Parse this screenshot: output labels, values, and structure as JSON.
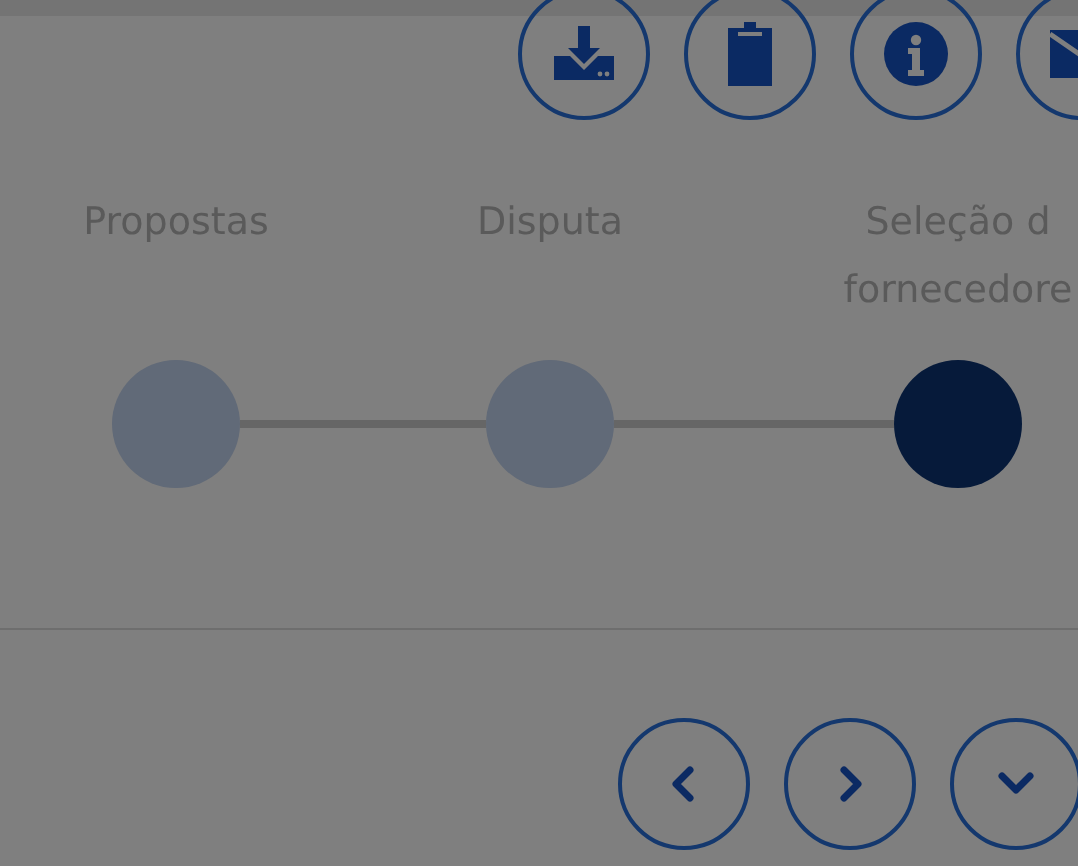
{
  "toolbar": {
    "buttons": [
      {
        "kind": "download"
      },
      {
        "kind": "clipboard"
      },
      {
        "kind": "info"
      },
      {
        "kind": "mail"
      }
    ]
  },
  "steps": [
    {
      "label_lines": [
        "Propostas"
      ],
      "current": false
    },
    {
      "label_lines": [
        "Disputa"
      ],
      "current": false
    },
    {
      "label_lines": [
        "Seleção d",
        "fornecedore"
      ],
      "current": true
    }
  ],
  "navigation": {
    "buttons": [
      {
        "kind": "previous"
      },
      {
        "kind": "next"
      },
      {
        "kind": "expand"
      }
    ]
  }
}
